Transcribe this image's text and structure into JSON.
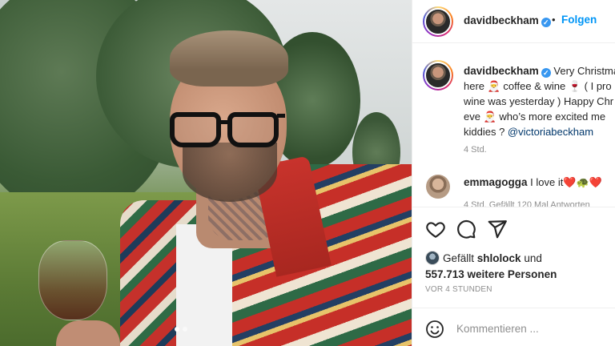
{
  "post": {
    "username": "davidbeckham",
    "follow_label": "Folgen",
    "separator": "•",
    "caption_lines": [
      "Very Christmas",
      "here 🎅 coffee & wine 🍷 ( I pro",
      "wine was yesterday ) Happy Chr",
      "eve 🎅 who’s more excited me",
      "kiddies ? "
    ],
    "caption_mention": "@victoriabeckham",
    "time": "4 Std.",
    "comment": {
      "username": "emmagogga",
      "text": "I love it❤️🐢❤️",
      "meta": "4 Std.  Gefällt 120 Mal  Antworten"
    },
    "likes": {
      "prefix": "Gefällt",
      "user": "shlolock",
      "connector": "und",
      "others": "557.713 weitere Personen"
    },
    "ago": "VOR 4 STUNDEN",
    "comment_input": {
      "placeholder": "Kommentieren ..."
    }
  },
  "icons": {
    "verified": "verified-badge-icon",
    "like": "heart-icon",
    "comment": "comment-bubble-icon",
    "share": "paper-plane-icon",
    "emoji": "smiley-icon"
  },
  "colors": {
    "accent": "#0095f6",
    "verified": "#3897f0",
    "muted": "#8e8e8e",
    "text": "#262626"
  }
}
